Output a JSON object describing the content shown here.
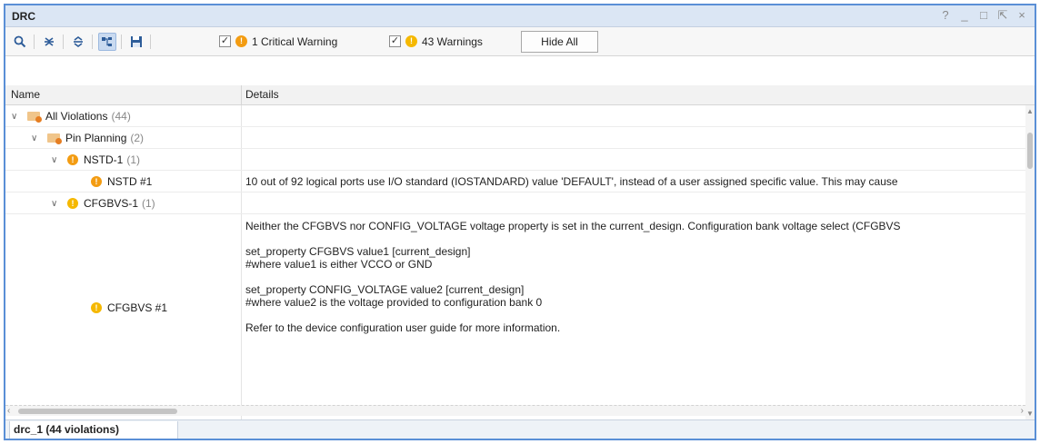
{
  "window": {
    "title": "DRC",
    "controls": [
      "?",
      "_",
      "□",
      "⇱",
      "×"
    ]
  },
  "toolbar": {
    "critical_label": "1 Critical Warning",
    "warnings_label": "43 Warnings",
    "hide_all_label": "Hide All",
    "critical_checked": true,
    "warnings_checked": true
  },
  "columns": {
    "name": "Name",
    "details": "Details"
  },
  "tree": {
    "all_violations": {
      "label": "All Violations",
      "count": "(44)"
    },
    "pin_planning": {
      "label": "Pin Planning",
      "count": "(2)"
    },
    "nstd_group": {
      "label": "NSTD-1",
      "count": "(1)"
    },
    "nstd_item": {
      "label": "NSTD #1",
      "details": "10 out of 92 logical ports use I/O standard (IOSTANDARD) value 'DEFAULT', instead of a user assigned specific value. This may cause"
    },
    "cfgbvs_group": {
      "label": "CFGBVS-1",
      "count": "(1)"
    },
    "cfgbvs_item": {
      "label": "CFGBVS #1",
      "details": [
        "Neither the CFGBVS nor CONFIG_VOLTAGE voltage property is set in the current_design.  Configuration bank voltage select (CFGBVS",
        "",
        "set_property CFGBVS value1 [current_design]",
        "#where value1 is either VCCO or GND",
        "",
        "set_property CONFIG_VOLTAGE value2 [current_design]",
        "#where value2 is the voltage provided to configuration bank 0",
        "",
        "Refer to the device configuration user guide for more information."
      ]
    }
  },
  "bottom_tab": "drc_1 (44 violations)",
  "colors": {
    "critical": "#f39c12",
    "warning": "#f5b800",
    "title_bar": "#dbe6f4",
    "frame_border": "#5a8fd6"
  }
}
